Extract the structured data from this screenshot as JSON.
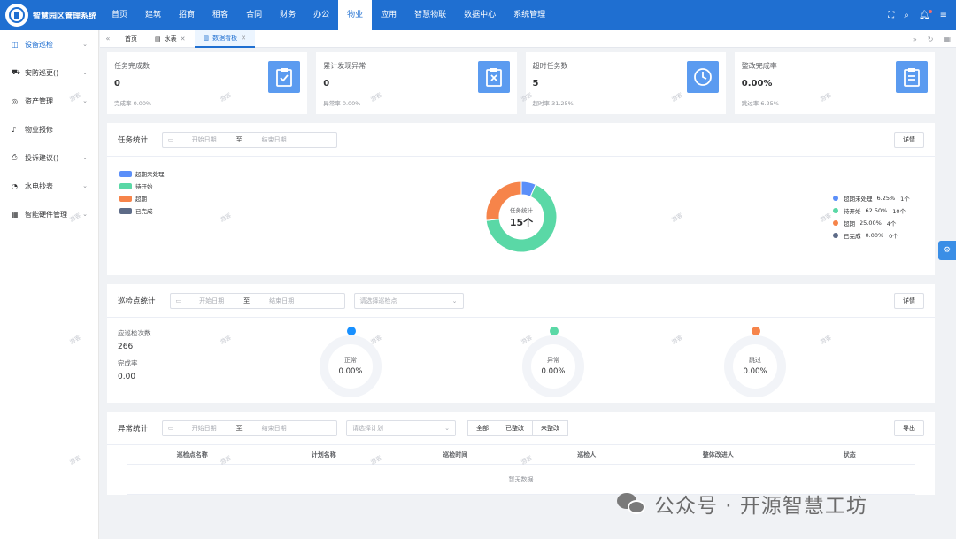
{
  "app": {
    "title": "智慧园区管理系统"
  },
  "nav": [
    "首页",
    "建筑",
    "招商",
    "租客",
    "合同",
    "财务",
    "办公",
    "物业",
    "应用",
    "智慧物联",
    "数据中心",
    "系统管理"
  ],
  "nav_active_index": 7,
  "sidebar": [
    {
      "label": "设备巡检",
      "icon": "camera-icon",
      "active": true
    },
    {
      "label": "安防巡更()",
      "icon": "truck-icon"
    },
    {
      "label": "资产管理",
      "icon": "globe-icon"
    },
    {
      "label": "物业报修",
      "icon": "bell-icon"
    },
    {
      "label": "投诉建议()",
      "icon": "printer-icon"
    },
    {
      "label": "水电抄表",
      "icon": "clock-icon"
    },
    {
      "label": "智能硬件管理",
      "icon": "grid-icon"
    }
  ],
  "tabs": [
    {
      "label": "首页"
    },
    {
      "label": "水表",
      "closable": true
    },
    {
      "label": "数据看板",
      "closable": true,
      "active": true
    }
  ],
  "cards": [
    {
      "title": "任务完成数",
      "value": "0",
      "sub": "完成率 0.00%",
      "icon": "clipboard-check-icon"
    },
    {
      "title": "累计发现异常",
      "value": "0",
      "sub": "异常率 0.00%",
      "icon": "clipboard-x-icon"
    },
    {
      "title": "超时任务数",
      "value": "5",
      "sub": "超时率 31.25%",
      "icon": "clock-icon"
    },
    {
      "title": "整改完成率",
      "value": "0.00%",
      "sub": "跳过率 6.25%",
      "icon": "document-icon"
    }
  ],
  "task_panel": {
    "title": "任务统计",
    "start_placeholder": "开始日期",
    "range_sep": "至",
    "end_placeholder": "结束日期",
    "detail_button": "详情",
    "center_label": "任务统计",
    "center_value": "15个"
  },
  "task_legend": [
    {
      "name": "超期未处理",
      "pct": "6.25%",
      "count": "1个",
      "color": "#5b8ff9"
    },
    {
      "name": "待开始",
      "pct": "62.50%",
      "count": "10个",
      "color": "#5ad8a6"
    },
    {
      "name": "超期",
      "pct": "25.00%",
      "count": "4个",
      "color": "#f6844a"
    },
    {
      "name": "已完成",
      "pct": "0.00%",
      "count": "0个",
      "color": "#5d6b87"
    }
  ],
  "patrol_panel": {
    "title": "巡检点统计",
    "start_placeholder": "开始日期",
    "range_sep": "至",
    "end_placeholder": "结束日期",
    "select_placeholder": "请选择巡检点",
    "detail_button": "详情",
    "due_label": "应巡检次数",
    "due_value": "266",
    "rate_label": "完成率",
    "rate_value": "0.00"
  },
  "patrol_gauges": [
    {
      "label": "正常",
      "value": "0.00%",
      "color": "#1890ff"
    },
    {
      "label": "异常",
      "value": "0.00%",
      "color": "#5ad8a6"
    },
    {
      "label": "跳过",
      "value": "0.00%",
      "color": "#f6844a"
    }
  ],
  "abnormal_panel": {
    "title": "异常统计",
    "start_placeholder": "开始日期",
    "range_sep": "至",
    "end_placeholder": "结束日期",
    "select_placeholder": "请选择计划",
    "filters": [
      "全部",
      "已整改",
      "未整改"
    ],
    "export_button": "导出",
    "columns": [
      "巡检点名称",
      "计划名称",
      "巡检时间",
      "巡检人",
      "整体改进人",
      "状态"
    ],
    "empty_text": "暂无数据"
  },
  "watermark_text": "游客",
  "footer_brand": "公众号 · 开源智慧工坊",
  "chart_data": {
    "type": "pie",
    "title": "任务统计",
    "total": 15,
    "categories": [
      "超期未处理",
      "待开始",
      "超期",
      "已完成"
    ],
    "values": [
      1,
      10,
      4,
      0
    ],
    "percent": [
      6.25,
      62.5,
      25.0,
      0.0
    ]
  }
}
